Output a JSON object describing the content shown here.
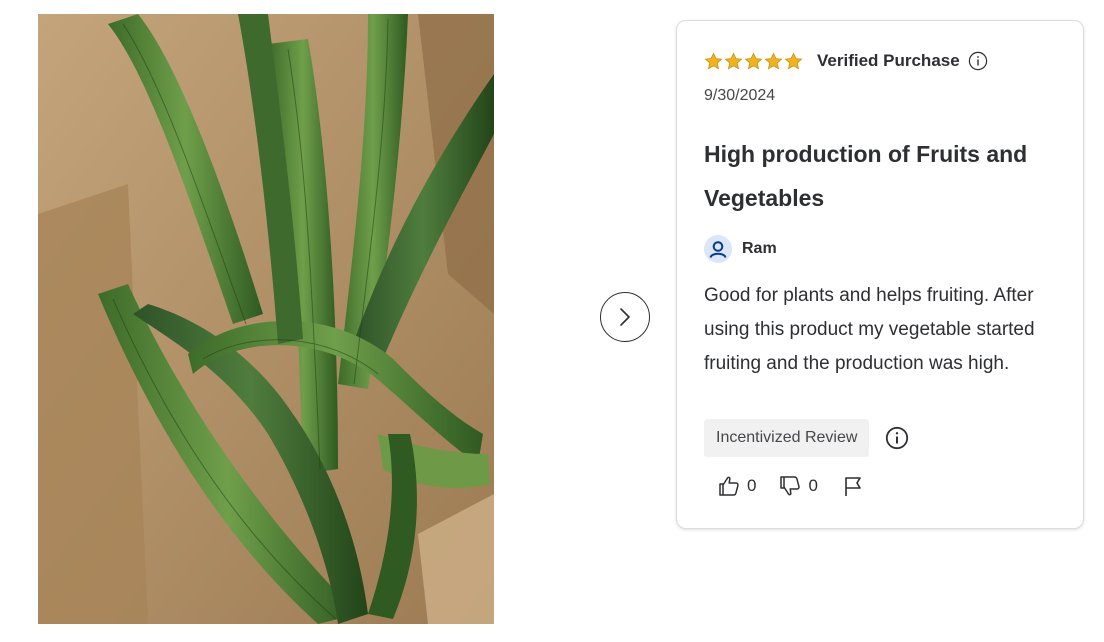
{
  "photo": {
    "alt_icon": "product-photo"
  },
  "carousel": {
    "next_icon": "chevron-right-icon"
  },
  "review": {
    "rating": 5,
    "rating_max": 5,
    "verified_label": "Verified Purchase",
    "date": "9/30/2024",
    "title": "High production of Fruits and Vegetables",
    "author": "Ram",
    "body": "Good for plants and helps fruiting. After using this product my vegetable started fruiting and the production was high.",
    "badge": "Incentivized Review",
    "helpful_count": "0",
    "unhelpful_count": "0"
  },
  "colors": {
    "star": "#f0b31f",
    "text": "#2e2f32",
    "badge_bg": "#f1f1f2",
    "avatar_bg": "#dbe7f7",
    "avatar_icon": "#0a3b8c",
    "card_border": "#dcdde0"
  }
}
